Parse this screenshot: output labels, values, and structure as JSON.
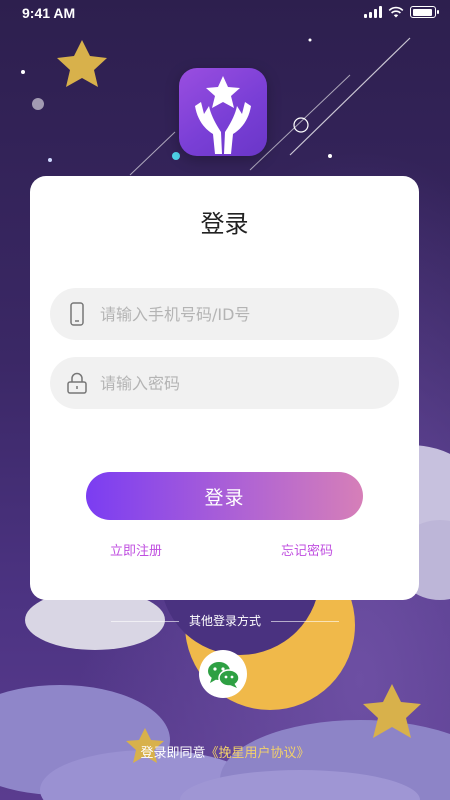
{
  "status_bar": {
    "time": "9:41 AM"
  },
  "login_card": {
    "title": "登录",
    "account_placeholder": "请输入手机号码/ID号",
    "password_placeholder": "请输入密码",
    "login_button": "登录",
    "register_link": "立即注册",
    "forgot_link": "忘记密码"
  },
  "other_login": {
    "label": "其他登录方式",
    "methods": [
      "wechat-icon"
    ]
  },
  "agreement": {
    "prefix": "登录即同意",
    "protocol": "《挽星用户协议》"
  },
  "colors": {
    "accent_purple": "#7b3df2",
    "accent_pink": "#d67fb8",
    "link": "#c04fe0",
    "protocol": "#f1d06b",
    "wechat_green": "#2ea043"
  }
}
